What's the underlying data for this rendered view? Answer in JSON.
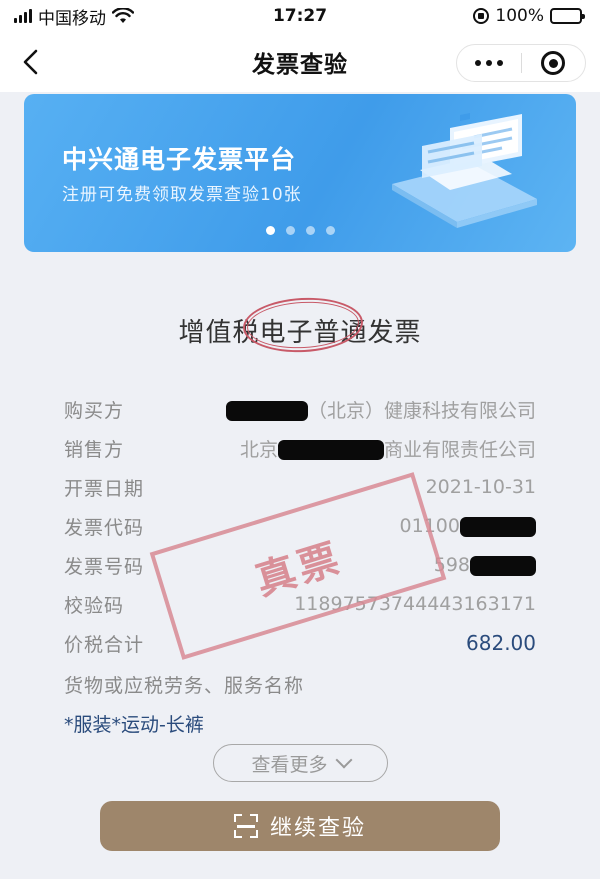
{
  "status_bar": {
    "carrier": "中国移动",
    "time": "17:27",
    "battery": "100%"
  },
  "nav": {
    "title": "发票查验"
  },
  "banner": {
    "title": "中兴通电子发票平台",
    "subtitle": "注册可免费领取发票查验10张",
    "dot_count": 4,
    "active_dot": 0
  },
  "invoice": {
    "type_title": "增值税电子普通发票",
    "fields": [
      {
        "label": "购买方",
        "value": "（北京）健康科技有限公司",
        "redacted_prefix": true
      },
      {
        "label": "销售方",
        "value": "北京",
        "value_suffix": "商业有限责任公司",
        "redacted_middle": true
      },
      {
        "label": "开票日期",
        "value": "2021-10-31"
      },
      {
        "label": "发票代码",
        "value": "01100",
        "redacted_suffix": true
      },
      {
        "label": "发票号码",
        "value": "598",
        "redacted_suffix": true
      },
      {
        "label": "校验码",
        "value": "11897573744443163171"
      },
      {
        "label": "价税合计",
        "value": "682.00"
      }
    ],
    "goods_label": "货物或应税劳务、服务名称",
    "goods_name": "*服装*运动-长裤",
    "stamp": "真票"
  },
  "actions": {
    "more_label": "查看更多",
    "verify_label": "继续查验"
  },
  "colors": {
    "accent_gold": "#9e866b",
    "value_blue": "#2a4b7c",
    "banner_blue": "#3f9cea",
    "stamp_red": "#d6808a"
  }
}
